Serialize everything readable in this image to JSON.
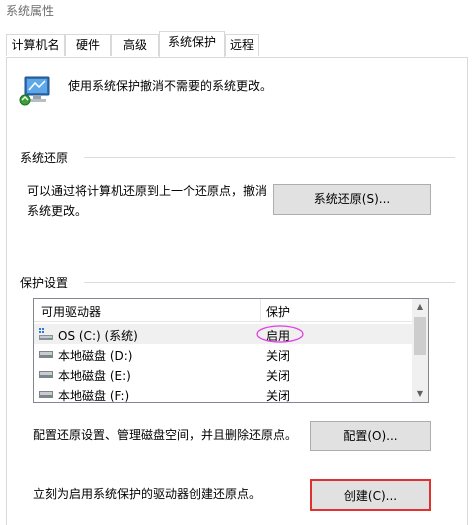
{
  "window": {
    "title": "系统属性"
  },
  "tabs": [
    {
      "label": "计算机名"
    },
    {
      "label": "硬件"
    },
    {
      "label": "高级"
    },
    {
      "label": "系统保护"
    },
    {
      "label": "远程"
    }
  ],
  "active_tab": "系统保护",
  "intro": {
    "text": "使用系统保护撤消不需要的系统更改。",
    "icon": "system-protection-icon"
  },
  "restore_section": {
    "heading": "系统还原",
    "description_line1": "可以通过将计算机还原到上一个还原点，撤消",
    "description_line2": "系统更改。",
    "button_label": "系统还原(S)..."
  },
  "protection_section": {
    "heading": "保护设置",
    "columns": [
      "可用驱动器",
      "保护"
    ],
    "drives": [
      {
        "name": "OS (C:) (系统)",
        "protection": "启用",
        "icon": "system-drive-icon",
        "selected": true
      },
      {
        "name": "本地磁盘 (D:)",
        "protection": "关闭",
        "icon": "drive-icon"
      },
      {
        "name": "本地磁盘 (E:)",
        "protection": "关闭",
        "icon": "drive-icon"
      },
      {
        "name": "本地磁盘 (F:)",
        "protection": "关闭",
        "icon": "drive-icon"
      }
    ],
    "configure_text": "配置还原设置、管理磁盘空间，并且删除还原点。",
    "configure_button": "配置(O)...",
    "create_text": "立刻为启用系统保护的驱动器创建还原点。",
    "create_button": "创建(C)..."
  },
  "colors": {
    "highlight_ellipse": "#e040e0",
    "highlight_box": "#e03030",
    "window_border": "#d9d9d9"
  }
}
